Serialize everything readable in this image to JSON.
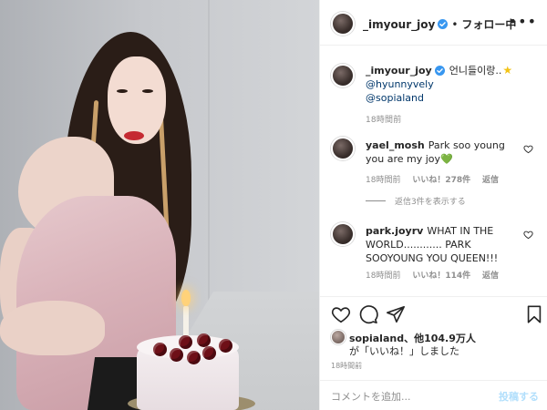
{
  "post": {
    "username": "_imyour_joy",
    "follow_status": "フォロー中",
    "separator": "•",
    "more_label": "•••"
  },
  "caption": {
    "username": "_imyour_joy",
    "text": "언니들이랑..",
    "star": "★",
    "mentions": [
      "@hyunnyvely",
      "@sopialand"
    ],
    "time": "18時間前"
  },
  "comments": [
    {
      "username": "yael_mosh",
      "text": "Park soo young you are my joy",
      "emoji": "💚",
      "time": "18時間前",
      "likes": "いいね！278件",
      "reply": "返信",
      "view_replies": "返信3件を表示する"
    },
    {
      "username": "park.joyrv",
      "text": "WHAT IN THE WORLD............ PARK SOOYOUNG YOU QUEEN!!!",
      "time": "18時間前",
      "likes": "いいね！114件",
      "reply": "返信"
    }
  ],
  "likes": {
    "line1": "sopialand、他104.9万人",
    "line2": "が「いいね！」しました"
  },
  "post_time": "18時間前",
  "comment_box": {
    "placeholder": "コメントを追加...",
    "post_label": "投稿する"
  },
  "colors": {
    "verified": "#3897f0",
    "link": "#00376b",
    "muted": "#8e8e8e",
    "post_disabled": "#b2dffc",
    "heart_emoji": "#3cbc34"
  }
}
